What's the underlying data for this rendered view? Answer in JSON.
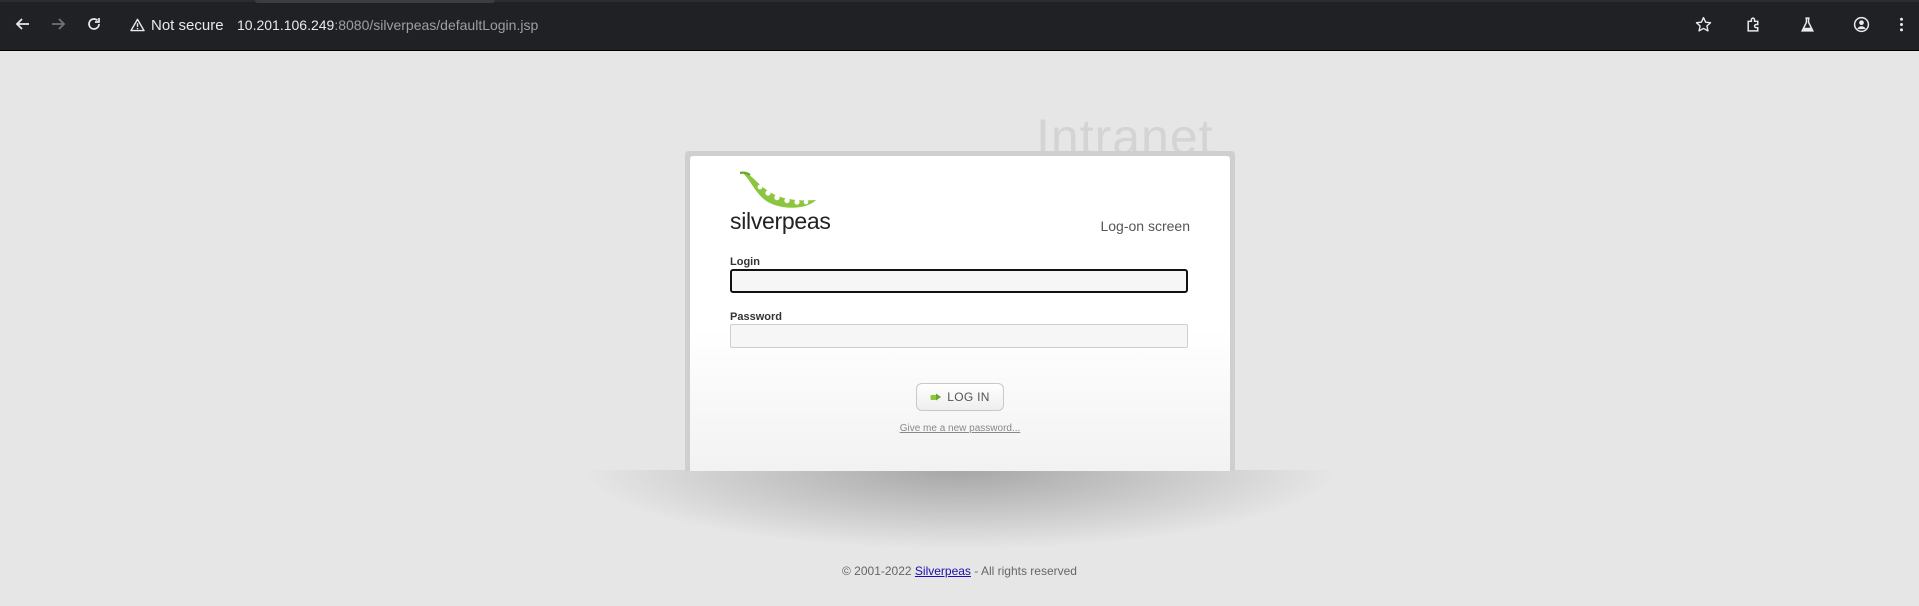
{
  "browser": {
    "security_label": "Not secure",
    "url_host": "10.201.106.249",
    "url_rest": ":8080/silverpeas/defaultLogin.jsp",
    "icons": [
      "back-icon",
      "forward-icon",
      "reload-icon",
      "warning-icon",
      "bookmark-star-icon",
      "extensions-icon",
      "labs-icon",
      "profile-icon",
      "menu-icon"
    ]
  },
  "page": {
    "watermark": "Intranet",
    "logo_text": "silverpeas",
    "screen_title": "Log-on screen",
    "login_label": "Login",
    "login_value": "",
    "password_label": "Password",
    "password_value": "",
    "login_button": "LOG IN",
    "forgot_link": "Give me a new password...",
    "footer_prefix": "© 2001-2022 ",
    "footer_link": "Silverpeas",
    "footer_suffix": " - All rights reserved"
  },
  "colors": {
    "background": "#e6e6e6",
    "chrome": "#202124",
    "logo_green": "#8cc63f"
  }
}
